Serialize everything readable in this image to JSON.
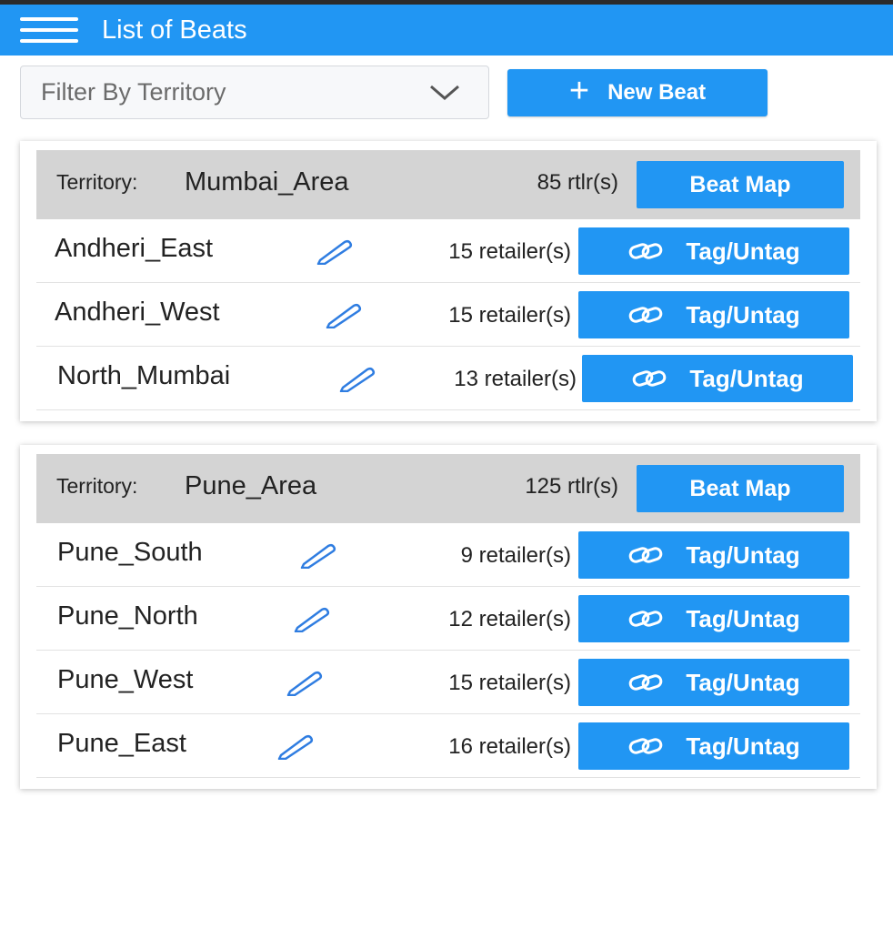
{
  "header": {
    "title": "List of Beats",
    "menu_icon": "hamburger-menu-icon"
  },
  "toolbar": {
    "filter_placeholder": "Filter By Territory",
    "filter_icon": "chevron-down-icon",
    "new_beat_label": "New Beat",
    "new_beat_icon": "plus-icon"
  },
  "colors": {
    "primary": "#2196f3",
    "header_gray": "#d4d4d4",
    "edit_icon": "#2f7de1"
  },
  "territories": [
    {
      "label": "Territory:",
      "name": "Mumbai_Area",
      "count": "85 rtlr(s)",
      "map_button": "Beat Map",
      "beats": [
        {
          "name": "Andheri_East",
          "retailers": "15 retailer(s)",
          "action": "Tag/Untag"
        },
        {
          "name": "Andheri_West",
          "retailers": "15 retailer(s)",
          "action": "Tag/Untag"
        },
        {
          "name": "North_Mumbai",
          "retailers": "13 retailer(s)",
          "action": "Tag/Untag"
        }
      ]
    },
    {
      "label": "Territory:",
      "name": "Pune_Area",
      "count": "125 rtlr(s)",
      "map_button": "Beat Map",
      "beats": [
        {
          "name": "Pune_South",
          "retailers": "9 retailer(s)",
          "action": "Tag/Untag"
        },
        {
          "name": "Pune_North",
          "retailers": "12 retailer(s)",
          "action": "Tag/Untag"
        },
        {
          "name": "Pune_West",
          "retailers": "15 retailer(s)",
          "action": "Tag/Untag"
        },
        {
          "name": "Pune_East",
          "retailers": "16 retailer(s)",
          "action": "Tag/Untag"
        }
      ]
    }
  ]
}
